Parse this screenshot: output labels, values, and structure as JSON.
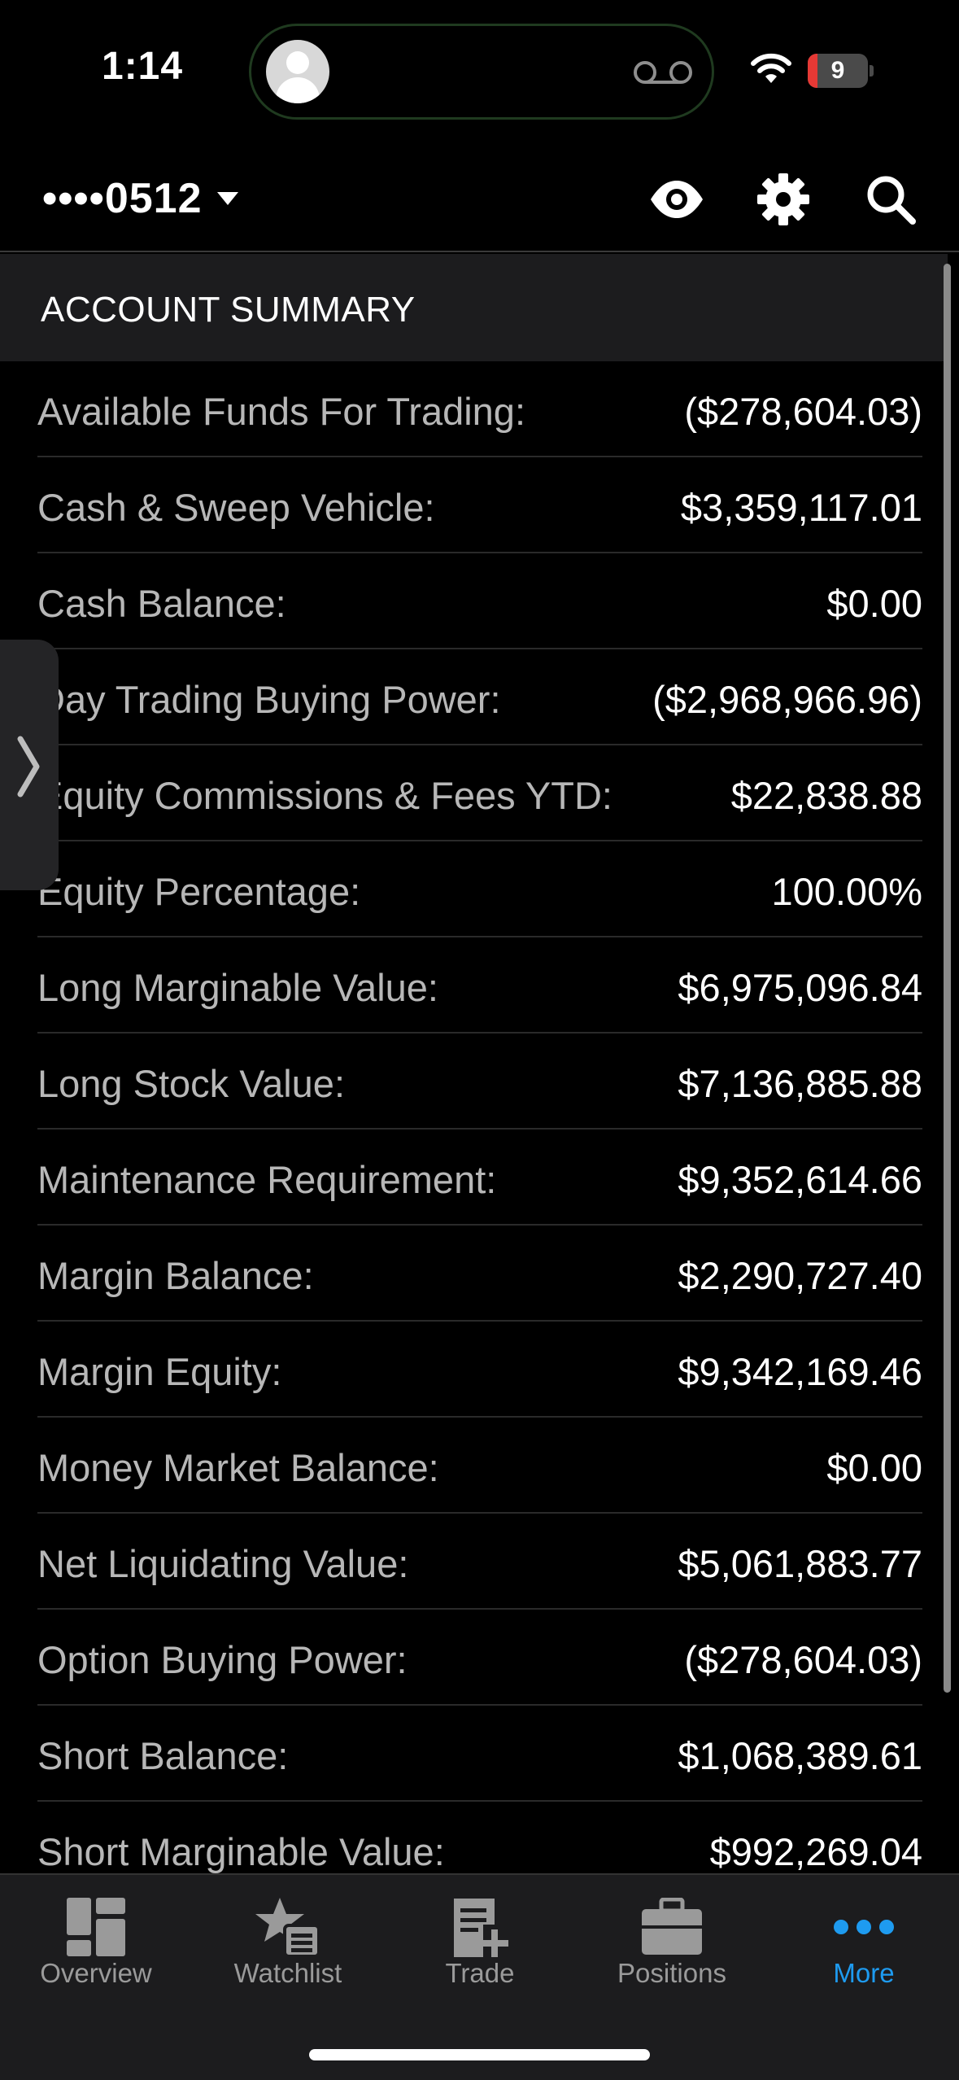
{
  "status_bar": {
    "time": "1:14",
    "battery_level": "9",
    "battery_color": "#e53935"
  },
  "header": {
    "account_masked": "••••0512",
    "icons": [
      "eye-icon",
      "gear-icon",
      "search-icon"
    ]
  },
  "section": {
    "title": "ACCOUNT SUMMARY"
  },
  "rows": [
    {
      "label": "Available Funds For Trading:",
      "value": "($278,604.03)"
    },
    {
      "label": "Cash & Sweep Vehicle:",
      "value": "$3,359,117.01"
    },
    {
      "label": "Cash Balance:",
      "value": "$0.00"
    },
    {
      "label": "Day Trading Buying Power:",
      "value": "($2,968,966.96)"
    },
    {
      "label": "Equity Commissions & Fees YTD:",
      "value": "$22,838.88"
    },
    {
      "label": "Equity Percentage:",
      "value": "100.00%"
    },
    {
      "label": "Long Marginable Value:",
      "value": "$6,975,096.84"
    },
    {
      "label": "Long Stock Value:",
      "value": "$7,136,885.88"
    },
    {
      "label": "Maintenance Requirement:",
      "value": "$9,352,614.66"
    },
    {
      "label": "Margin Balance:",
      "value": "$2,290,727.40"
    },
    {
      "label": "Margin Equity:",
      "value": "$9,342,169.46"
    },
    {
      "label": "Money Market Balance:",
      "value": "$0.00"
    },
    {
      "label": "Net Liquidating Value:",
      "value": "$5,061,883.77"
    },
    {
      "label": "Option Buying Power:",
      "value": "($278,604.03)"
    },
    {
      "label": "Short Balance:",
      "value": "$1,068,389.61"
    },
    {
      "label": "Short Marginable Value:",
      "value": "$992,269.04"
    }
  ],
  "tabbar": {
    "active_color": "#1e9bf0",
    "tabs": [
      {
        "label": "Overview",
        "icon": "overview-icon"
      },
      {
        "label": "Watchlist",
        "icon": "watchlist-icon"
      },
      {
        "label": "Trade",
        "icon": "trade-icon"
      },
      {
        "label": "Positions",
        "icon": "positions-icon"
      },
      {
        "label": "More",
        "icon": "more-icon",
        "active": true
      }
    ]
  }
}
